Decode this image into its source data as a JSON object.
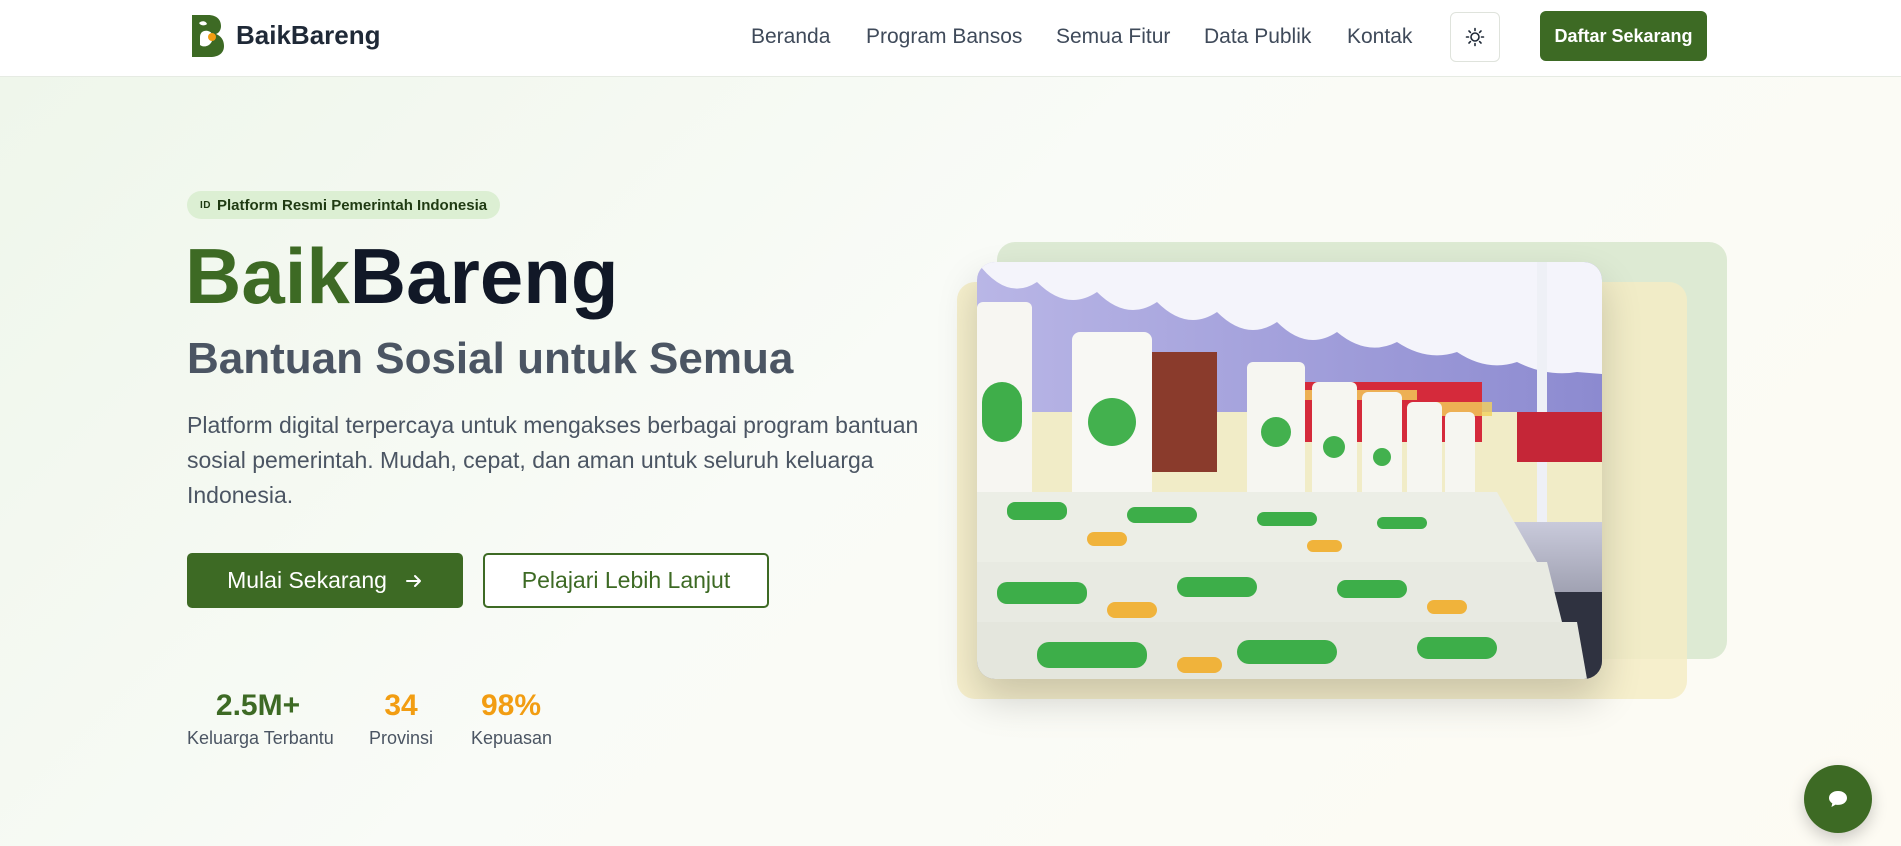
{
  "header": {
    "brand": "BaikBareng",
    "nav": [
      "Beranda",
      "Program Bansos",
      "Semua Fitur",
      "Data Publik",
      "Kontak"
    ],
    "theme_icon": "sun-icon",
    "cta_label": "Daftar Sekarang"
  },
  "hero": {
    "badge_flag": "ID",
    "badge_text": "Platform Resmi Pemerintah Indonesia",
    "title_part1": "Baik",
    "title_part2": "Bareng",
    "subtitle": "Bantuan Sosial untuk Semua",
    "description": "Platform digital terpercaya untuk mengakses berbagai program bantuan sosial pemerintah. Mudah, cepat, dan aman untuk seluruh keluarga Indonesia.",
    "primary_button": "Mulai Sekarang",
    "primary_button_icon": "arrow-right-icon",
    "secondary_button": "Pelajari Lebih Lanjut",
    "stats": [
      {
        "value": "2.5M+",
        "label": "Keluarga Terbantu",
        "color": "#3d6a24"
      },
      {
        "value": "34",
        "label": "Provinsi",
        "color": "#f29d12"
      },
      {
        "value": "98%",
        "label": "Kepuasan",
        "color": "#f29d12"
      }
    ]
  },
  "chat_icon": "chat-bubble-icon",
  "colors": {
    "primary": "#3d6a24",
    "accent": "#f29d12",
    "badge_bg": "#dcefd3"
  }
}
